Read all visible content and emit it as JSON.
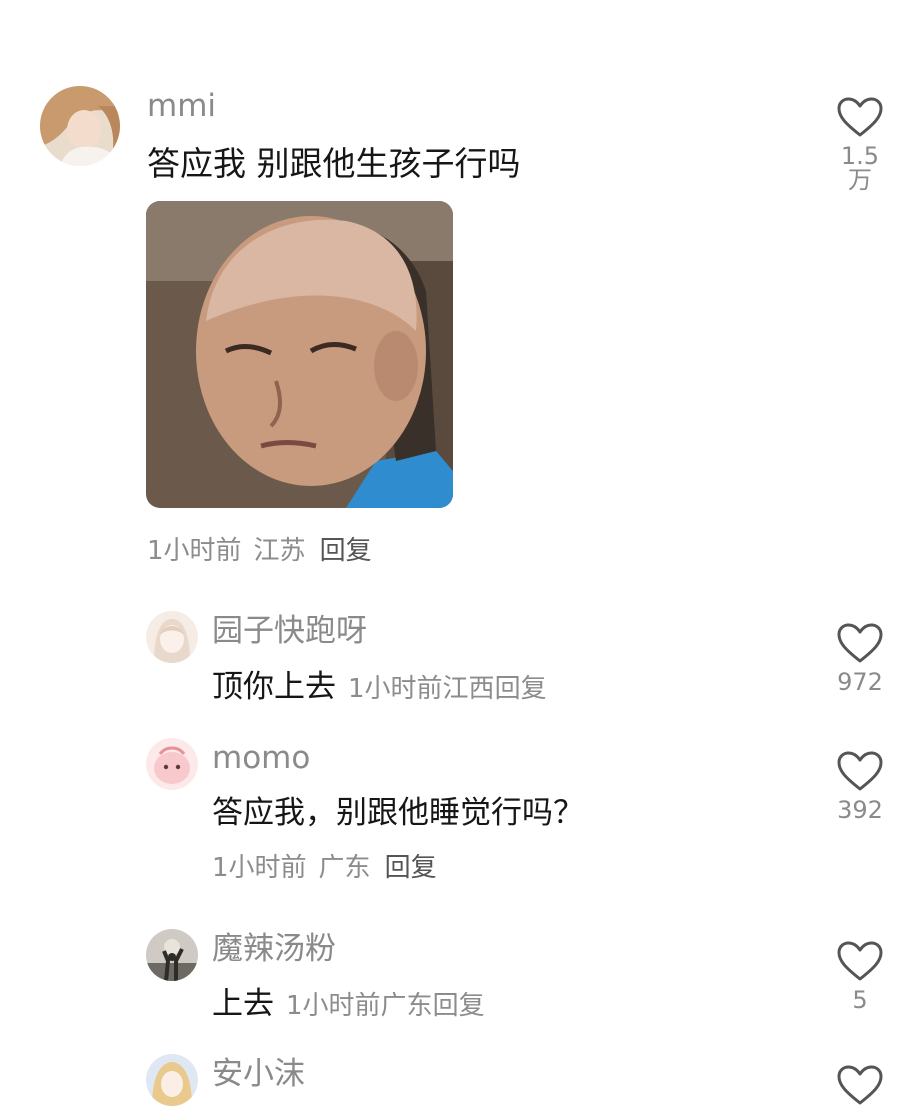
{
  "main_comment": {
    "username": "mmi",
    "text": "答应我 别跟他生孩子行吗",
    "time": "1小时前",
    "location": "江苏",
    "reply_label": "回复",
    "likes": "1.5万",
    "avatar_icon": "user-avatar-icon",
    "sticker_icon": "meme-sticker-image"
  },
  "replies": [
    {
      "username": "园子快跑呀",
      "text": "顶你上去",
      "time": "1小时前",
      "location": "江西",
      "reply_label": "回复",
      "likes": "972"
    },
    {
      "username": "momo",
      "text": "答应我，别跟他睡觉行吗？",
      "time": "1小时前",
      "location": "广东",
      "reply_label": "回复",
      "likes": "392"
    },
    {
      "username": "魔辣汤粉",
      "text": "上去",
      "time": "1小时前",
      "location": "广东",
      "reply_label": "回复",
      "likes": "5"
    },
    {
      "username": "安小沫",
      "text": "",
      "likes": ""
    }
  ],
  "colors": {
    "username": "#8a8a8a",
    "text": "#161616",
    "meta": "#8c8c8c",
    "icon": "#555555"
  }
}
